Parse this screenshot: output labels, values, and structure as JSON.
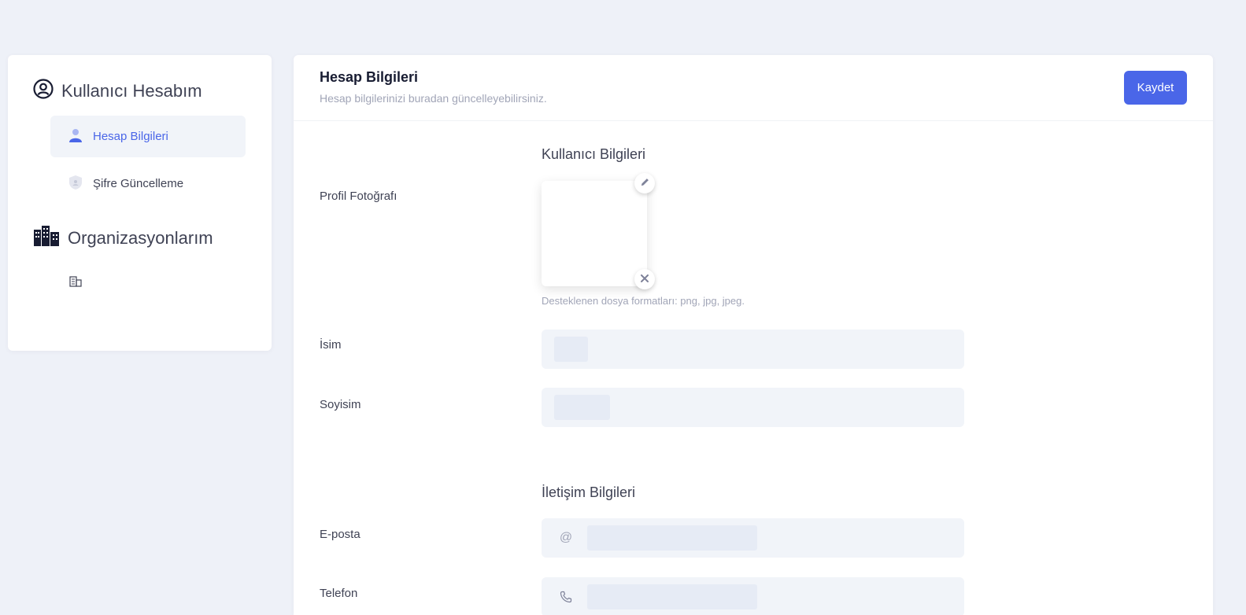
{
  "sidebar": {
    "account_title": "Kullanıcı Hesabım",
    "items": [
      {
        "label": "Hesap Bilgileri",
        "icon": "user-icon",
        "active": true
      },
      {
        "label": "Şifre Güncelleme",
        "icon": "shield-icon",
        "active": false
      }
    ],
    "orgs_title": "Organizasyonlarım"
  },
  "main": {
    "title": "Hesap Bilgileri",
    "subtitle": "Hesap bilgilerinizi buradan güncelleyebilirsiniz.",
    "save_label": "Kaydet",
    "user_section": {
      "title": "Kullanıcı Bilgileri",
      "photo_label": "Profil Fotoğrafı",
      "photo_hint": "Desteklenen dosya formatları: png, jpg, jpeg.",
      "name_label": "İsim",
      "surname_label": "Soyisim"
    },
    "contact_section": {
      "title": "İletişim Bilgileri",
      "email_label": "E-posta",
      "email_icon": "@",
      "phone_label": "Telefon"
    }
  },
  "colors": {
    "accent": "#4a66e8",
    "page_bg": "#eef1f8",
    "input_bg": "#f1f4f9"
  }
}
